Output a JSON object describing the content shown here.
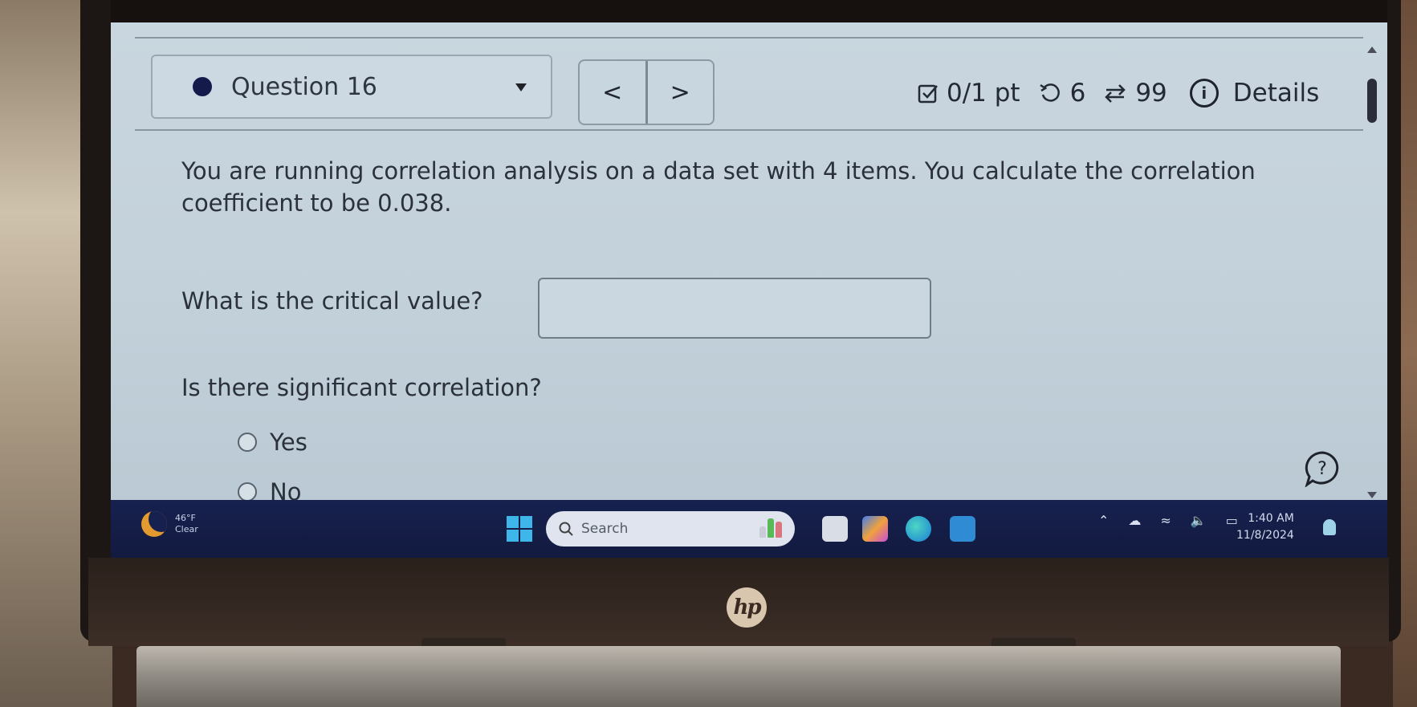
{
  "header": {
    "question_label": "Question 16",
    "prev_label": "<",
    "next_label": ">",
    "score": "0/1 pt",
    "retries": "6",
    "submissions": "99",
    "details_label": "Details"
  },
  "question": {
    "prompt": "You are running correlation analysis on a data set with 4 items. You calculate the correlation coefficient to be 0.038.",
    "critical_value_label": "What is the critical value?",
    "critical_value_input": "",
    "significance_label": "Is there significant correlation?",
    "options": [
      {
        "label": "Yes",
        "selected": false
      },
      {
        "label": "No",
        "selected": false
      }
    ]
  },
  "taskbar": {
    "weather_temp": "46°F",
    "weather_cond": "Clear",
    "search_placeholder": "Search",
    "time": "1:40 AM",
    "date": "11/8/2024",
    "pinned_apps": [
      "task-view",
      "copilot",
      "edge",
      "myhp"
    ]
  },
  "device": {
    "brand": "hp"
  }
}
